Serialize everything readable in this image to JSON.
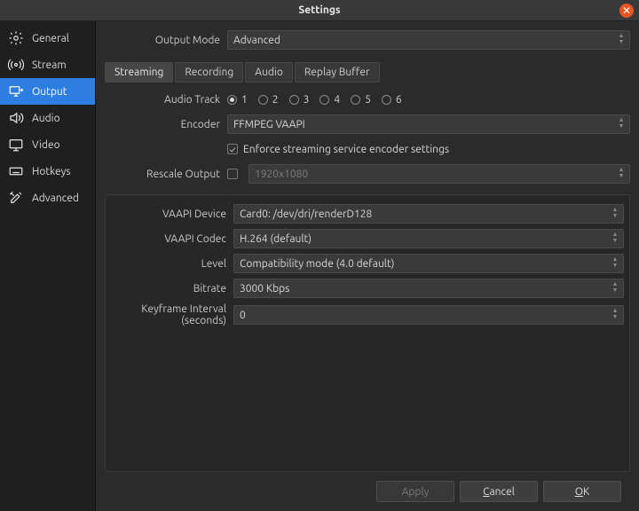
{
  "titlebar": {
    "title": "Settings"
  },
  "sidebar": {
    "items": [
      {
        "label": "General"
      },
      {
        "label": "Stream"
      },
      {
        "label": "Output"
      },
      {
        "label": "Audio"
      },
      {
        "label": "Video"
      },
      {
        "label": "Hotkeys"
      },
      {
        "label": "Advanced"
      }
    ]
  },
  "output_mode": {
    "label": "Output Mode",
    "value": "Advanced"
  },
  "tabs": {
    "streaming": "Streaming",
    "recording": "Recording",
    "audio": "Audio",
    "replay": "Replay Buffer"
  },
  "audio_track": {
    "label": "Audio Track",
    "options": [
      "1",
      "2",
      "3",
      "4",
      "5",
      "6"
    ],
    "selected": "1"
  },
  "encoder": {
    "label": "Encoder",
    "value": "FFMPEG VAAPI"
  },
  "enforce": {
    "label": "Enforce streaming service encoder settings",
    "checked": true
  },
  "rescale": {
    "label": "Rescale Output",
    "checked": false,
    "value": "1920x1080"
  },
  "vaapi_device": {
    "label": "VAAPI Device",
    "value": "Card0: /dev/dri/renderD128"
  },
  "vaapi_codec": {
    "label": "VAAPI Codec",
    "value": "H.264 (default)"
  },
  "level": {
    "label": "Level",
    "value": "Compatibility mode  (4.0 default)"
  },
  "bitrate": {
    "label": "Bitrate",
    "value": "3000 Kbps"
  },
  "keyframe": {
    "label": "Keyframe Interval (seconds)",
    "value": "0"
  },
  "buttons": {
    "apply": "Apply",
    "cancel": "Cancel",
    "ok": "OK"
  }
}
